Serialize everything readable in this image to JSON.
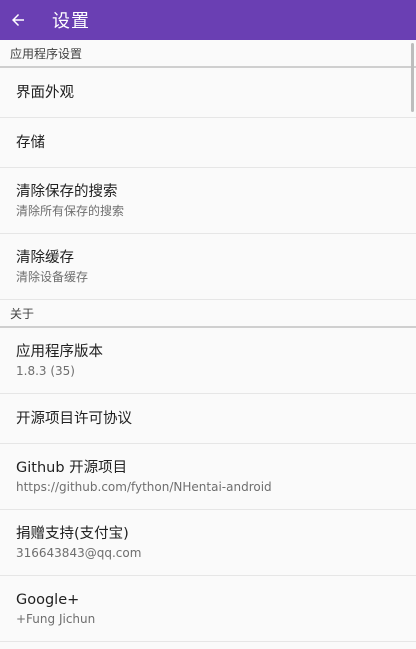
{
  "toolbar": {
    "title": "设置",
    "back_icon": "arrow-back-icon",
    "color": "#6a3fb3"
  },
  "app_settings": {
    "header": "应用程序设置",
    "items": [
      {
        "title": "界面外观"
      },
      {
        "title": "存储"
      },
      {
        "title": "清除保存的搜索",
        "summary": "清除所有保存的搜索"
      },
      {
        "title": "清除缓存",
        "summary": "清除设备缓存"
      }
    ]
  },
  "about": {
    "header": "关于",
    "items": [
      {
        "title": "应用程序版本",
        "summary": "1.8.3 (35)"
      },
      {
        "title": "开源项目许可协议"
      },
      {
        "title": "Github 开源项目",
        "summary": "https://github.com/fython/NHentai-android"
      },
      {
        "title": "捐赠支持(支付宝)",
        "summary": "316643843@qq.com"
      },
      {
        "title": "Google+",
        "summary": "+Fung Jichun"
      }
    ]
  }
}
